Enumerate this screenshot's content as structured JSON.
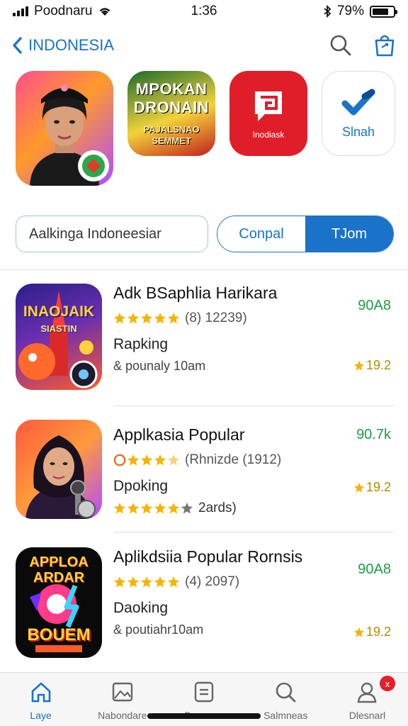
{
  "status_bar": {
    "carrier": "Poodnaru",
    "time": "1:36",
    "battery_percent": "79%",
    "battery_level": 0.79
  },
  "nav": {
    "back_label": "INDONESIA",
    "accent_color": "#1a73c8"
  },
  "featured": {
    "tile2_title": "MPOKAN DRONAIN",
    "tile2_subtitle": "PAJALSNAO SEMMET",
    "tile3_label": "Inodiask",
    "tile4_label": "Slnah"
  },
  "segment": {
    "search_text": "Aalkinga Indoneesiar",
    "option_left": "Conpal",
    "option_right": "TJom"
  },
  "list": [
    {
      "icon_text_top": "INAOJAIK",
      "icon_text_sub": "SIASTIN",
      "title": "Adk BSaphlia Harikara",
      "rating_text": "(8) 12239)",
      "subtitle": "Rapking",
      "subtitle2": "& pounaly 10am",
      "size": "90A8",
      "rank": "19.2"
    },
    {
      "title": "Applkasia Popular",
      "rating_text": "(Rhnizde (1912)",
      "subtitle": "Dpoking",
      "subtitle2": "2ards)",
      "size": "90.7k",
      "rank": "19.2"
    },
    {
      "icon_text_top": "APPLOA ARDAR",
      "icon_text_bottom": "BOUEM",
      "title": "Aplikdsiia Popular Rornsis",
      "rating_text": "(4) 2097)",
      "subtitle": "Daoking",
      "subtitle2": "& poutiahr10am",
      "size": "90A8",
      "rank": "19.2"
    }
  ],
  "tabs": [
    {
      "label": "Laye",
      "icon": "home-icon",
      "active": true
    },
    {
      "label": "Nabondare",
      "icon": "image-icon",
      "active": false
    },
    {
      "label": "Denmaw",
      "icon": "list-icon",
      "active": false
    },
    {
      "label": "Salmneas",
      "icon": "search-icon",
      "active": false
    },
    {
      "label": "Dlesnarl",
      "icon": "profile-icon",
      "active": false,
      "badge": "x"
    }
  ],
  "colors": {
    "accent": "#1a73c8",
    "size_green": "#1f9a46",
    "star_gold": "#f4b400",
    "badge_red": "#e0202a"
  }
}
